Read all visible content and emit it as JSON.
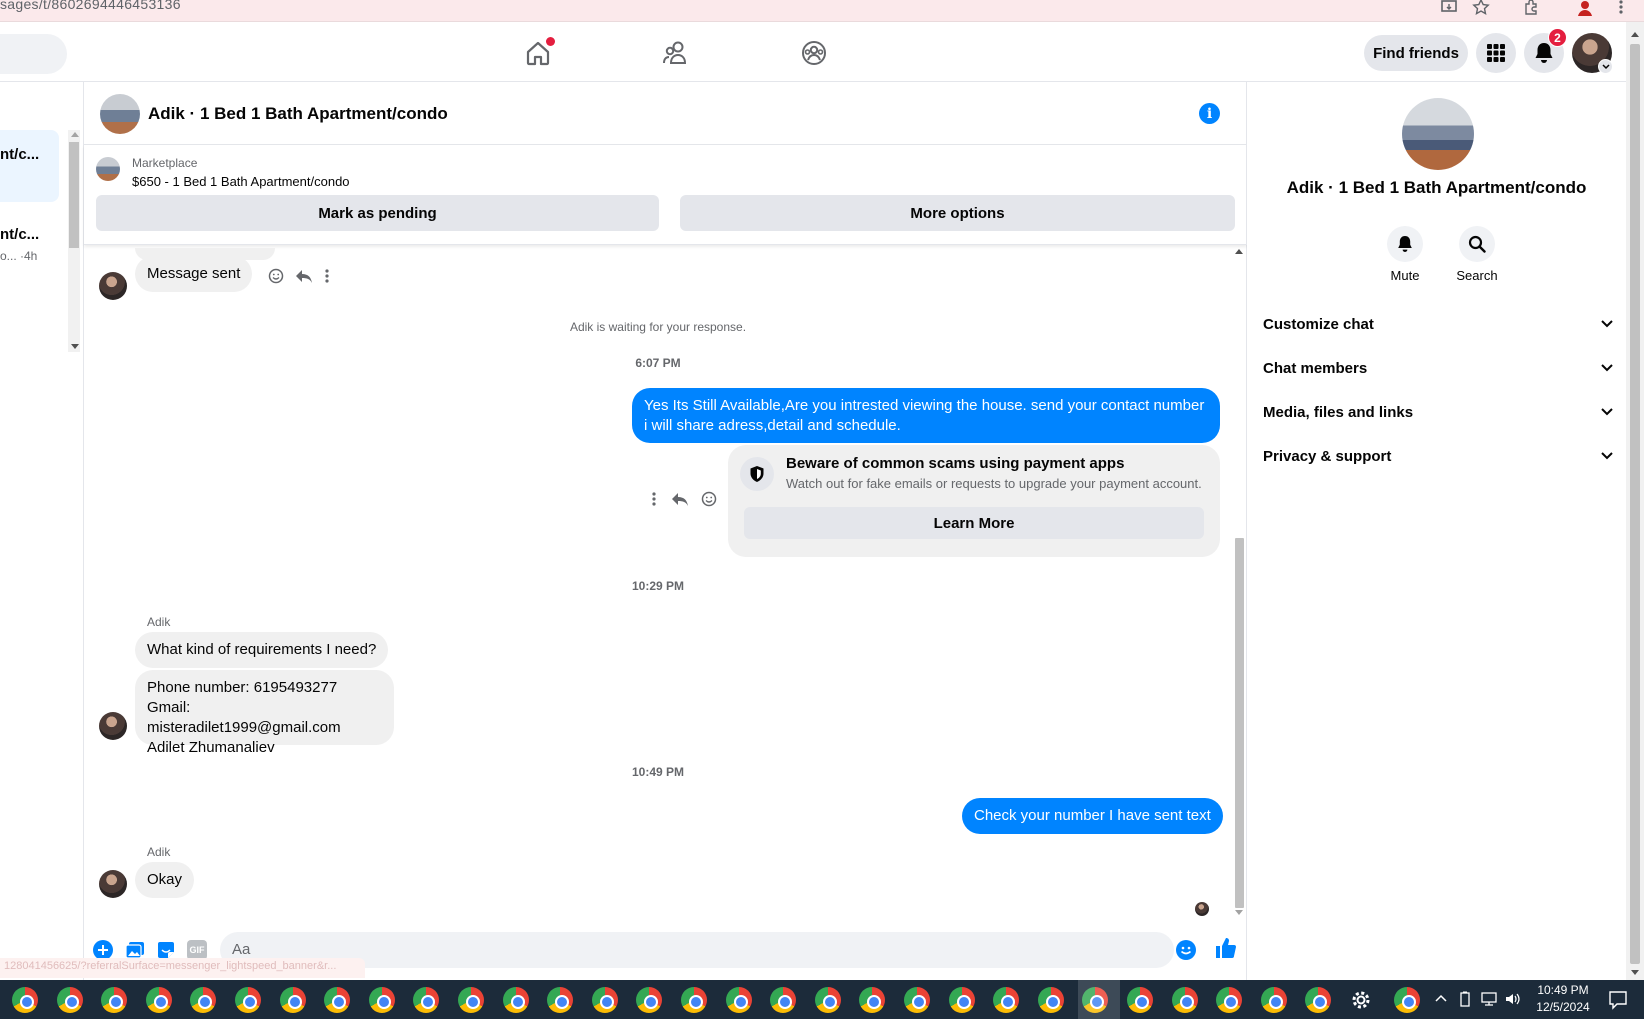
{
  "browser": {
    "url_fragment": "sages/t/8602694446453136",
    "status_url": "128041456625/?referralSurface=messenger_lightspeed_banner&r..."
  },
  "topnav": {
    "find_friends": "Find friends",
    "notification_count": "2"
  },
  "left_panel": {
    "item1_title": "nt/c...",
    "item2_title": "nt/c...",
    "item2_meta": "o... ·4h"
  },
  "chat": {
    "header_title": "Adik · 1 Bed 1 Bath Apartment/condo",
    "marketplace_label": "Marketplace",
    "listing": "$650 - 1 Bed 1 Bath Apartment/condo",
    "mark_pending": "Mark as pending",
    "more_options": "More options",
    "msg_sent": "Message sent",
    "waiting": "Adik is waiting for your response.",
    "ts1": "6:07 PM",
    "out_msg1": "Yes Its Still Available,Are you intrested viewing the house. send your contact number i will share adress,detail and schedule.",
    "scam_title": "Beware of common scams using payment apps",
    "scam_body": "Watch out for fake emails or requests to upgrade your payment account.",
    "learn_more": "Learn More",
    "ts2": "10:29 PM",
    "sender": "Adik",
    "in_msg1": "What kind of requirements I need?",
    "in_msg2_line1": "Phone number: 6195493277",
    "in_msg2_line2": "Gmail: misteradilet1999@gmail.com",
    "in_msg2_line3": "Adilet Zhumanaliev",
    "ts3": "10:49 PM",
    "out_msg2": "Check your number I have sent text",
    "in_msg3": "Okay",
    "composer_placeholder": "Aa"
  },
  "right_panel": {
    "title": "Adik · 1 Bed 1 Bath Apartment/condo",
    "mute": "Mute",
    "search": "Search",
    "sections": [
      "Customize chat",
      "Chat members",
      "Media, files and links",
      "Privacy & support"
    ]
  },
  "taskbar": {
    "time": "10:49 PM",
    "date": "12/5/2024"
  },
  "colors": {
    "accent": "#0084ff",
    "badge": "#e41e3f"
  }
}
